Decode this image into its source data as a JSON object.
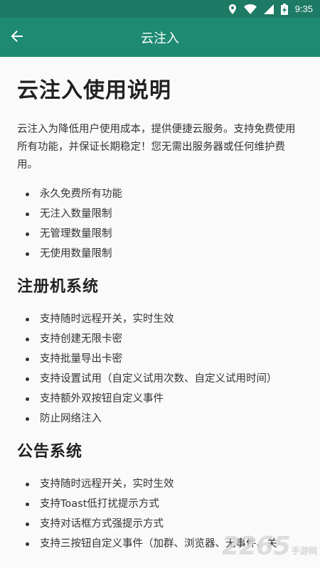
{
  "status_bar": {
    "time": "9:35",
    "icons": [
      "location-icon",
      "wifi-icon",
      "signal-icon",
      "battery-charging-icon"
    ]
  },
  "app_bar": {
    "back_icon": "arrow-left-icon",
    "title": "云注入"
  },
  "doc": {
    "title": "云注入使用说明",
    "intro": "云注入为降低用户使用成本，提供便捷云服务。支持免费使用所有功能，并保证长期稳定！您无需出服务器或任何维护费用。",
    "features": [
      "永久免费所有功能",
      "无注入数量限制",
      "无管理数量限制",
      "无使用数量限制"
    ],
    "sections": [
      {
        "title": "注册机系统",
        "items": [
          "支持随时远程开关，实时生效",
          "支持创建无限卡密",
          "支持批量导出卡密",
          "支持设置试用（自定义试用次数、自定义试用时间）",
          "支持额外双按钮自定义事件",
          "防止网络注入"
        ]
      },
      {
        "title": "公告系统",
        "items": [
          "支持随时远程开关，实时生效",
          "支持Toast低打扰提示方式",
          "支持对话框方式强提示方式",
          "支持三按钮自定义事件（加群、浏览器、无事件、关"
        ]
      }
    ]
  },
  "watermark": {
    "number": "2265",
    "suffix": "手游网"
  },
  "colors": {
    "status_bar": "#1d7a64",
    "app_bar": "#1e8a72",
    "background": "#fafafa"
  }
}
